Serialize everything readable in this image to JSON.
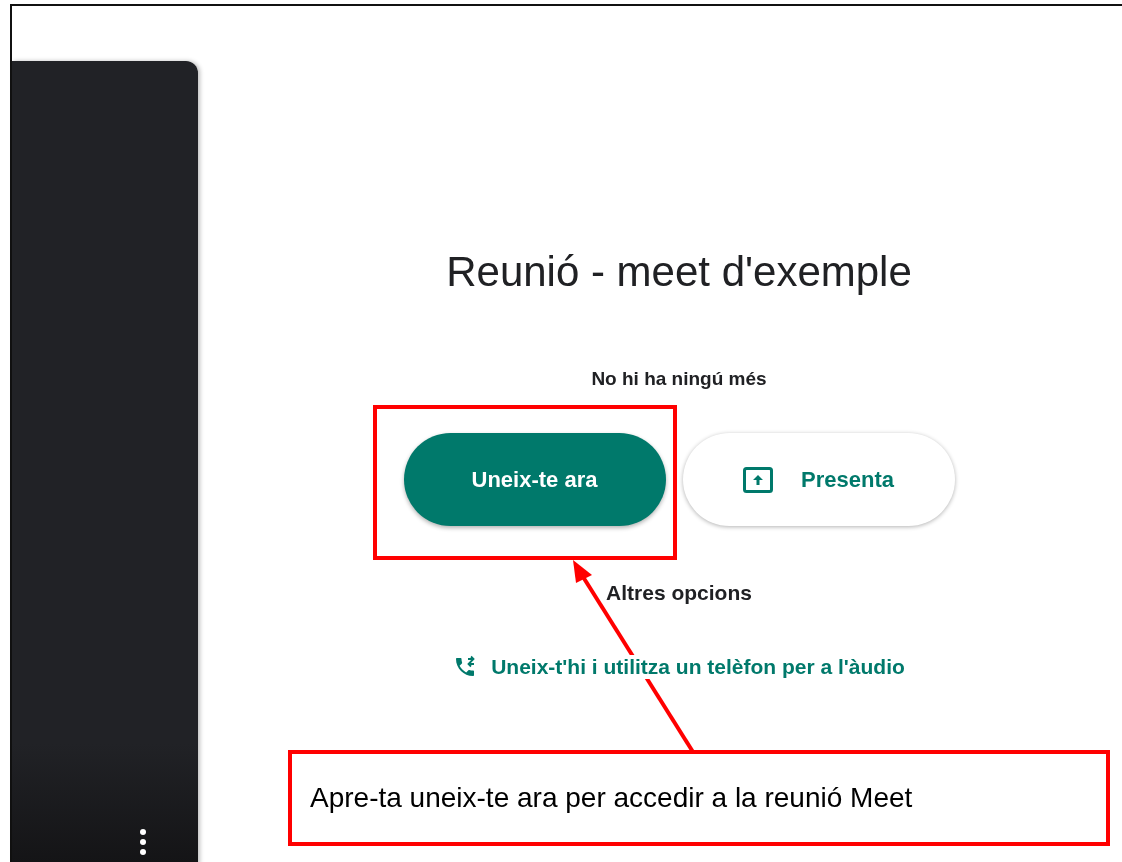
{
  "meeting": {
    "title": "Reunió - meet d'exemple",
    "status": "No hi ha ningú més"
  },
  "buttons": [
    {
      "label": "Uneix-te ara",
      "kind": "primary"
    },
    {
      "label": "Presenta",
      "kind": "present"
    }
  ],
  "other_options": {
    "heading": "Altres opcions",
    "phone_link": "Uneix-t'hi i utilitza un telèfon per a l'àudio"
  },
  "callout": {
    "text": "Apre-ta uneix-te ara per accedir a la reunió Meet"
  }
}
